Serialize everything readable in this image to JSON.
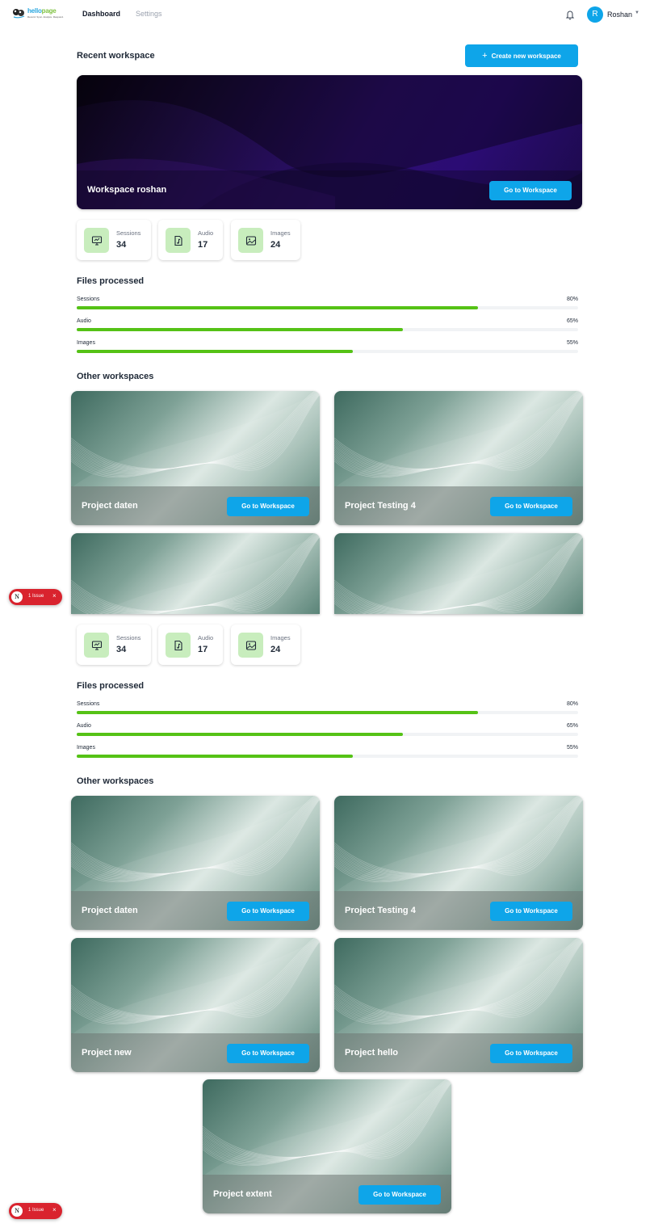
{
  "nav": {
    "logo_word_a": "hello",
    "logo_word_b": "page",
    "logo_tagline": "Record. Sync. Analyze. Respond.",
    "dashboard": "Dashboard",
    "settings": "Settings",
    "avatar_initial": "R",
    "user_name": "Roshan"
  },
  "recent": {
    "title": "Recent workspace",
    "create_label": "Create new workspace",
    "workspace_name": "Workspace roshan",
    "go_label": "Go to Workspace"
  },
  "stats": [
    {
      "label": "Sessions",
      "value": "34",
      "icon": "monitor-icon"
    },
    {
      "label": "Audio",
      "value": "17",
      "icon": "audio-file-icon"
    },
    {
      "label": "Images",
      "value": "24",
      "icon": "image-icon"
    }
  ],
  "files": {
    "title": "Files processed",
    "rows": [
      {
        "label": "Sessions",
        "value": "80%",
        "fraction": 0.8
      },
      {
        "label": "Audio",
        "value": "65%",
        "fraction": 0.65
      },
      {
        "label": "Images",
        "value": "55%",
        "fraction": 0.55
      }
    ]
  },
  "other": {
    "title": "Other workspaces",
    "go_label": "Go to Workspace",
    "workspaces": [
      "Project daten",
      "Project Testing 4",
      "Project new",
      "Project hello",
      "Project extent"
    ]
  },
  "issue": {
    "logo": "N",
    "label": "1 Issue",
    "close": "×"
  },
  "colors": {
    "accent": "#0ea5e9",
    "progress": "#55c216",
    "icon_bg": "#c8edbd",
    "issue": "#d9232e"
  }
}
